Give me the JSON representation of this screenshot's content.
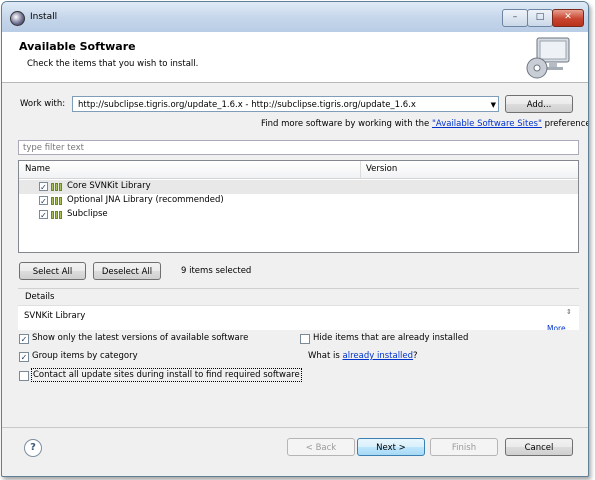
{
  "window": {
    "title": "Install",
    "controls": [
      "minimize",
      "maximize",
      "close"
    ],
    "minimize_glyph": "–",
    "maximize_glyph": "□",
    "close_glyph": "✕"
  },
  "header": {
    "title": "Available Software",
    "subtitle": "Check the items that you wish to install."
  },
  "work_with": {
    "label": "Work with:",
    "value": "http://subclipse.tigris.org/update_1.6.x - http://subclipse.tigris.org/update_1.6.x",
    "add_button": "Add...",
    "more_prefix": "Find more software by working with the ",
    "more_link": "\"Available Software Sites\"",
    "more_suffix": " preferences."
  },
  "filter": {
    "placeholder": "type filter text"
  },
  "table": {
    "columns": [
      "Name",
      "Version"
    ],
    "rows": [
      {
        "name": "Core SVNKit Library",
        "version": "",
        "checked": true,
        "selected": true
      },
      {
        "name": "Optional JNA Library (recommended)",
        "version": "",
        "checked": true,
        "selected": false
      },
      {
        "name": "Subclipse",
        "version": "",
        "checked": true,
        "selected": false
      }
    ]
  },
  "selection": {
    "select_all": "Select All",
    "deselect_all": "Deselect All",
    "count_text": "9 items selected"
  },
  "details": {
    "label": "Details",
    "text": "SVNKit Library",
    "more_link": "More..."
  },
  "options": {
    "show_latest": {
      "label": "Show only the latest versions of available software",
      "checked": true
    },
    "hide_installed": {
      "label": "Hide items that are already installed",
      "checked": false
    },
    "group_by_category": {
      "label": "Group items by category",
      "checked": true
    },
    "what_is_prefix": "What is ",
    "already_installed_link": "already installed",
    "what_is_suffix": "?",
    "contact_sites": {
      "label": "Contact all update sites during install to find required software",
      "checked": false
    }
  },
  "footer": {
    "help": "?",
    "back": "< Back",
    "next": "Next >",
    "finish": "Finish",
    "cancel": "Cancel"
  },
  "colors": {
    "link": "#0033cc",
    "title_bar": "#c5d6ea",
    "dialog_bg": "#f0f0f0"
  }
}
